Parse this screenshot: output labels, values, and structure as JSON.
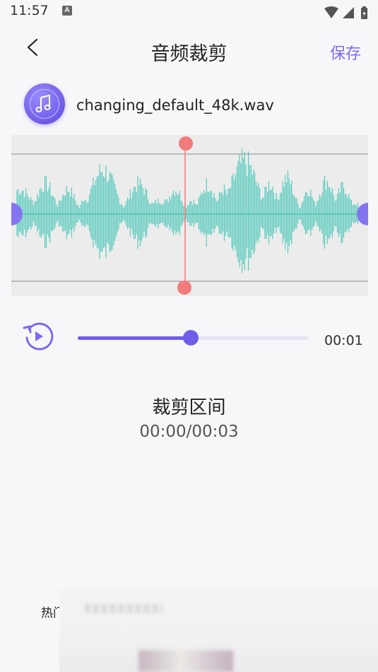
{
  "status_bar": {
    "time": "11:57",
    "notification_icon": "a-icon",
    "icons": [
      "wifi-icon",
      "signal-icon",
      "battery-icon"
    ]
  },
  "header": {
    "title": "音频裁剪",
    "save_label": "保存",
    "back_icon": "chevron-left-icon"
  },
  "file": {
    "name": "changing_default_48k.wav",
    "icon": "music-note-icon"
  },
  "waveform": {
    "playhead_icon": "playhead-marker",
    "start_handle_icon": "trim-start-handle",
    "end_handle_icon": "trim-end-handle"
  },
  "player": {
    "replay_icon": "replay-icon",
    "current_time": "00:01",
    "progress": 0.49
  },
  "range": {
    "label": "裁剪区间",
    "value": "00:00/00:03"
  },
  "bottom": {
    "hot_label": "热门"
  },
  "colors": {
    "accent": "#6e5ee8",
    "wave": "#3cc4b4",
    "playhead": "#f27a7a",
    "save": "#7b6cf0"
  }
}
